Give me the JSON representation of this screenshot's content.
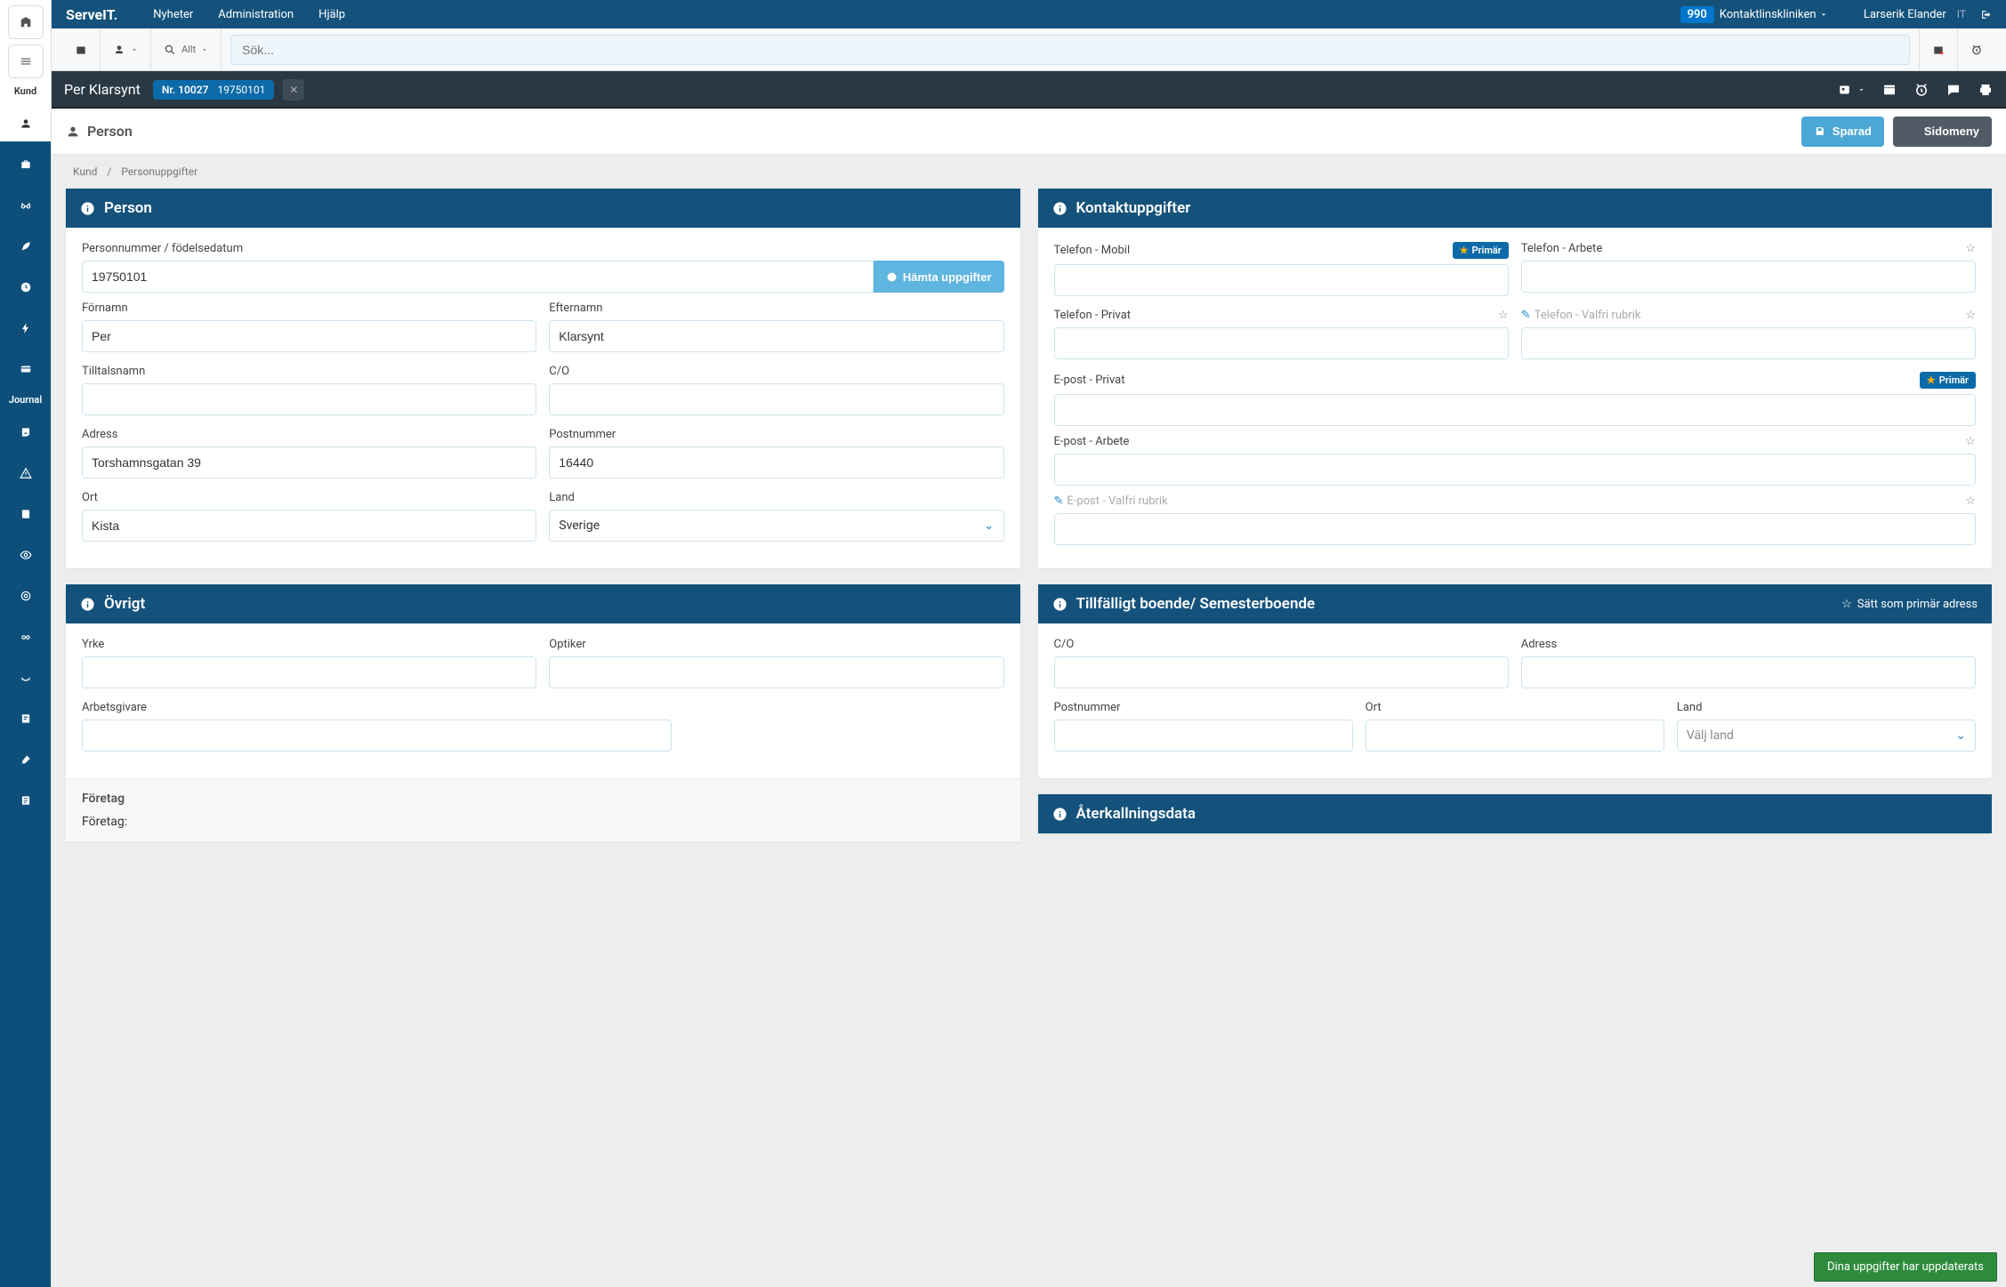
{
  "topbar": {
    "brand": "ServeIT.",
    "nav": [
      "Nyheter",
      "Administration",
      "Hjälp"
    ],
    "clinic_badge": "990",
    "clinic_name": "Kontaktlinskliniken",
    "user_name": "Larserik Elander",
    "user_tag": "IT"
  },
  "toolbar": {
    "filter_label": "Allt",
    "search_placeholder": "Sök..."
  },
  "leftrail": {
    "label_kund": "Kund",
    "label_journal": "Journal"
  },
  "customer": {
    "name": "Per Klarsynt",
    "nr_label": "Nr. 10027",
    "dob": "19750101"
  },
  "pagehead": {
    "title": "Person",
    "saved": "Sparad",
    "sidomeny": "Sidomeny"
  },
  "breadcrumb": {
    "a": "Kund",
    "b": "Personuppgifter"
  },
  "person_panel": {
    "title": "Person",
    "pnr_label": "Personnummer / födelsedatum",
    "pnr_value": "19750101",
    "fetch": "Hämta uppgifter",
    "fornamn_label": "Förnamn",
    "fornamn_value": "Per",
    "efternamn_label": "Efternamn",
    "efternamn_value": "Klarsynt",
    "tilltal_label": "Tilltalsnamn",
    "tilltal_value": "",
    "co_label": "C/O",
    "co_value": "",
    "adress_label": "Adress",
    "adress_value": "Torshamnsgatan 39",
    "postnr_label": "Postnummer",
    "postnr_value": "16440",
    "ort_label": "Ort",
    "ort_value": "Kista",
    "land_label": "Land",
    "land_value": "Sverige"
  },
  "contact_panel": {
    "title": "Kontaktuppgifter",
    "tel_mobil": "Telefon - Mobil",
    "tel_arbete": "Telefon - Arbete",
    "tel_privat": "Telefon - Privat",
    "tel_custom_placeholder": "Telefon - Valfri rubrik",
    "epost_privat": "E-post - Privat",
    "epost_arbete": "E-post - Arbete",
    "epost_custom_placeholder": "E-post - Valfri rubrik",
    "primar": "Primär"
  },
  "ovrigt_panel": {
    "title": "Övrigt",
    "yrke_label": "Yrke",
    "optiker_label": "Optiker",
    "arbetsgivare_label": "Arbetsgivare",
    "foretag_title": "Företag",
    "foretag_label": "Företag:"
  },
  "temp_panel": {
    "title": "Tillfälligt boende/ Semesterboende",
    "set_primary": "Sätt som primär adress",
    "co_label": "C/O",
    "adress_label": "Adress",
    "postnr_label": "Postnummer",
    "ort_label": "Ort",
    "land_label": "Land",
    "land_placeholder": "Välj land"
  },
  "recall_panel": {
    "title": "Återkallningsdata"
  },
  "toast": "Dina uppgifter har uppdaterats"
}
